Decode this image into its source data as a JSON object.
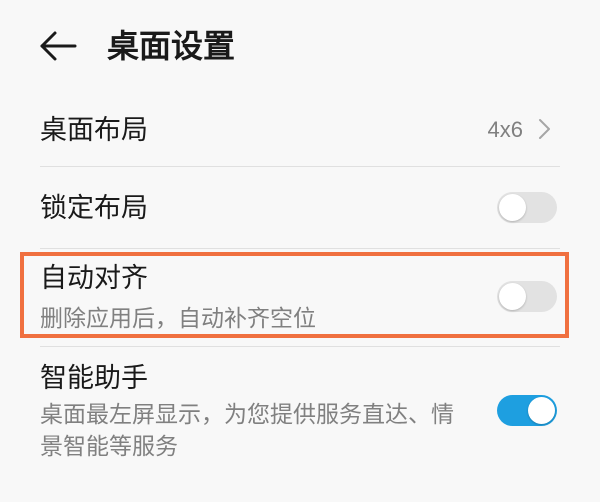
{
  "header": {
    "title": "桌面设置",
    "back_icon": "back-arrow-icon"
  },
  "settings": {
    "layout": {
      "label": "桌面布局",
      "value": "4x6",
      "icon": "chevron-right-icon"
    },
    "lock_layout": {
      "label": "锁定布局",
      "toggle_on": false
    },
    "auto_align": {
      "label": "自动对齐",
      "description": "删除应用后，自动补齐空位",
      "toggle_on": false,
      "highlighted": true
    },
    "smart_assistant": {
      "label": "智能助手",
      "description": "桌面最左屏显示，为您提供服务直达、情景智能等服务",
      "toggle_on": true
    }
  },
  "colors": {
    "background": "#f8f8f8",
    "text_primary": "#1a1a1a",
    "text_secondary": "#808080",
    "divider": "#e0e0e0",
    "toggle_off": "#e2e2e2",
    "accent": "#1e9fe0",
    "highlight_border": "#f07040"
  }
}
